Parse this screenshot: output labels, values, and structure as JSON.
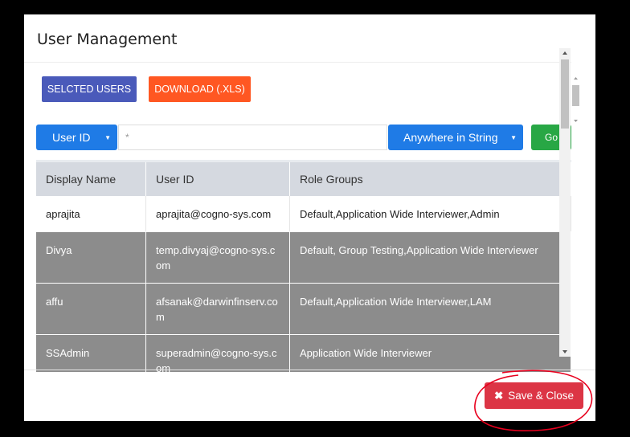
{
  "modal": {
    "title": "User Management"
  },
  "toolbar": {
    "selected_users_label": "SELCTED USERS",
    "download_label": "DOWNLOAD (.XLS)"
  },
  "search": {
    "field_select_value": "User ID",
    "query_value": "*",
    "match_select_value": "Anywhere in String",
    "go_label": "Go"
  },
  "table": {
    "headers": [
      "Display Name",
      "User ID",
      "Role Groups"
    ],
    "rows": [
      {
        "display_name": "aprajita",
        "user_id": "aprajita@cogno-sys.com",
        "role_groups": "Default,Application Wide Interviewer,Admin"
      },
      {
        "display_name": "Divya",
        "user_id": "temp.divyaj@cogno-sys.com",
        "role_groups": "Default, Group Testing,Application Wide Interviewer"
      },
      {
        "display_name": "affu",
        "user_id": "afsanak@darwinfinserv.com",
        "role_groups": "Default,Application Wide Interviewer,LAM"
      },
      {
        "display_name": "SSAdmin",
        "user_id": "superadmin@cogno-sys.com",
        "role_groups": "Application Wide Interviewer"
      }
    ]
  },
  "footer": {
    "save_close_label": "Save & Close"
  },
  "icons": {
    "save_close": "close-icon",
    "select_caret": "caret-down-icon"
  },
  "colors": {
    "annotation_circle": "#e8001e",
    "save_button": "#dc3545",
    "primary": "#1f7be6",
    "go_button": "#28a745"
  }
}
